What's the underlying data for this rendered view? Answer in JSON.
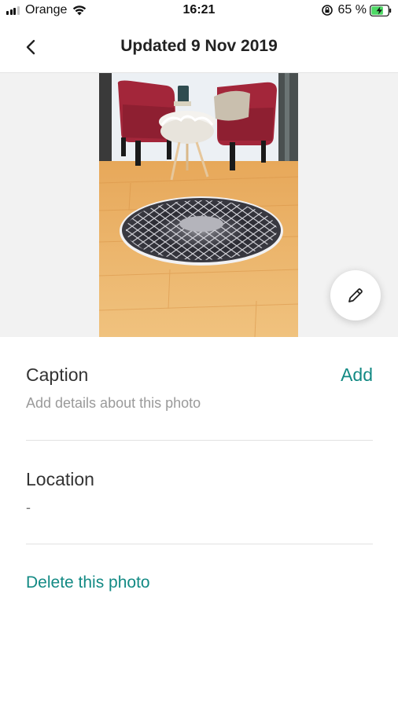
{
  "status_bar": {
    "carrier": "Orange",
    "time": "16:21",
    "battery_percent": "65 %",
    "signal_bars": 3,
    "battery_level": 0.65,
    "charging": true
  },
  "nav": {
    "title": "Updated 9 Nov 2019",
    "back_icon": "chevron-left-icon"
  },
  "photo": {
    "edit_icon": "pencil-icon"
  },
  "caption": {
    "label": "Caption",
    "action": "Add",
    "placeholder": "Add details about this photo"
  },
  "location": {
    "label": "Location",
    "value": "-"
  },
  "actions": {
    "delete": "Delete this photo"
  },
  "colors": {
    "accent": "#138a84",
    "muted_text": "#9a9a9a",
    "photo_bg": "#f2f2f2"
  }
}
